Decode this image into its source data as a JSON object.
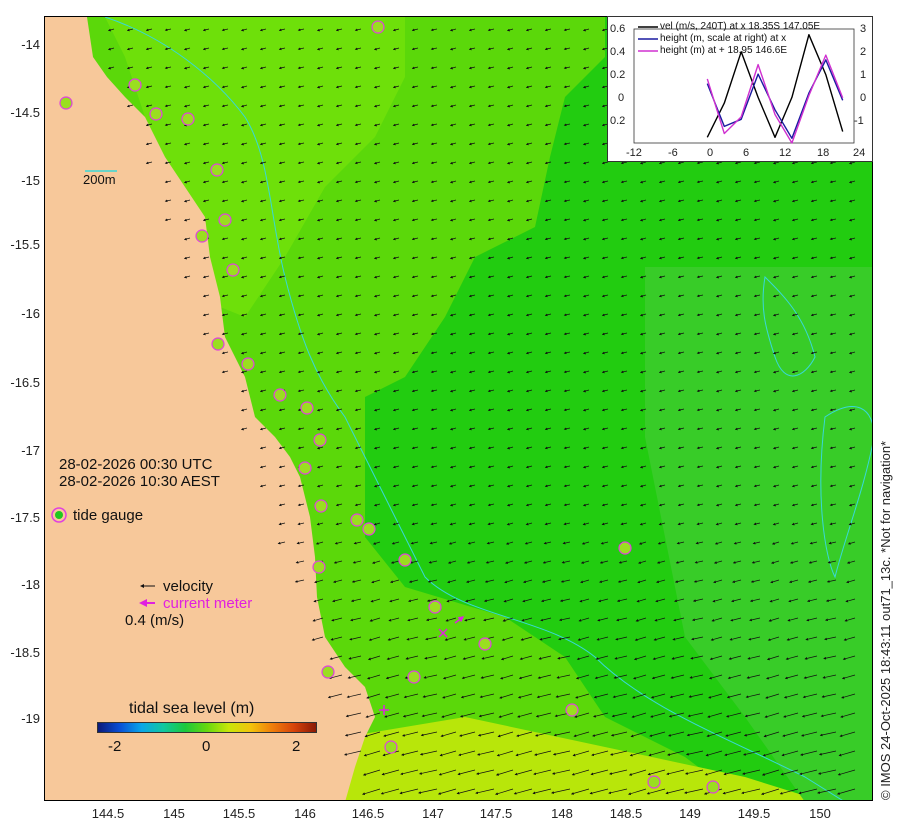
{
  "map": {
    "y_ticks": [
      "-14",
      "-14.5",
      "-15",
      "-15.5",
      "-16",
      "-16.5",
      "-17",
      "-17.5",
      "-18",
      "-18.5",
      "-19"
    ],
    "x_ticks": [
      "144.5",
      "145",
      "145.5",
      "146",
      "146.5",
      "147",
      "147.5",
      "148",
      "148.5",
      "149",
      "149.5",
      "150"
    ],
    "scale_label": "200m",
    "datetime_utc": "28-02-2026 00:30 UTC",
    "datetime_aest": "28-02-2026 10:30 AEST",
    "tide_gauge_label": "tide gauge",
    "velocity_label": "velocity",
    "current_meter_label": "current meter",
    "reference_speed": "0.4 (m/s)",
    "colorbar_title": "tidal sea level (m)",
    "colorbar_ticks": [
      "-2",
      "0",
      "2"
    ],
    "watermark": "© IMOS 24-Oct-2025 18:43:11 out71_13c. *Not for navigation*",
    "colors": {
      "land": "#f7c89a",
      "shelf_sea": "#5bd80a",
      "deep_sea": "#22cc10",
      "contour": "#38d8d8",
      "gauge_ring": "#e040e0",
      "current_meter": "#e020e0"
    }
  },
  "inset": {
    "legend": [
      "vel (m/s, 240T) at x 18.35S 147.05E",
      "height (m, scale at right) at x",
      "height (m) at + 18.95 146.6E"
    ],
    "left_ticks": [
      "0.6",
      "0.4",
      "0.2",
      "0",
      "0.2"
    ],
    "right_ticks": [
      "3",
      "2",
      "1",
      "0",
      "-1"
    ],
    "x_ticks": [
      "-12",
      "-6",
      "0",
      "6",
      "12",
      "18",
      "24"
    ]
  },
  "chart_data": {
    "type": "line",
    "x": [
      0,
      3,
      6,
      9,
      12,
      15,
      18,
      21,
      24
    ],
    "xlim": [
      -13,
      26
    ],
    "series": [
      {
        "name": "vel (m/s, 240T) at x 18.35S 147.05E",
        "color": "#000000",
        "axis": "left",
        "values": [
          -0.3,
          0.0,
          0.45,
          0.05,
          -0.3,
          0.05,
          0.6,
          0.25,
          -0.25
        ]
      },
      {
        "name": "height (m, scale at right) at x",
        "color": "#1a1aa0",
        "axis": "right",
        "values": [
          0.9,
          -0.9,
          -0.6,
          1.3,
          -0.2,
          -1.4,
          0.5,
          1.9,
          0.2
        ]
      },
      {
        "name": "height (m) at + 18.95 146.6E",
        "color": "#d030d0",
        "axis": "right",
        "values": [
          1.1,
          -1.2,
          -0.5,
          1.7,
          -0.4,
          -1.6,
          0.4,
          2.1,
          0.3
        ]
      }
    ]
  }
}
